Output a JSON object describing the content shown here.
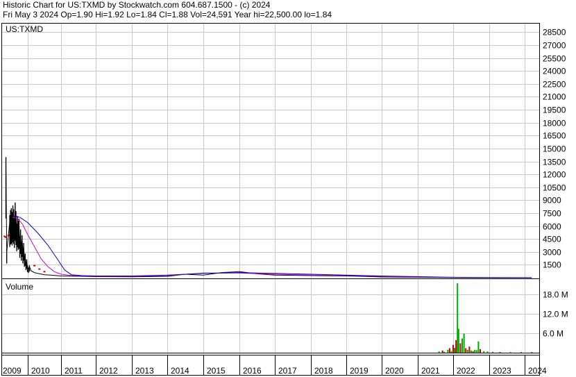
{
  "header": {
    "title": "Historic Chart for US:TXMD by Stockwatch.com 604.687.1500 - (c) 2024",
    "quote": "Fri May  3 2024   Op=1.90  Hi=1.92  Lo=1.84  Cl=1.88  Vol=24,591  Year hi=22,500.00  lo=1.84"
  },
  "colors": {
    "price": "#000000",
    "ma_short": "#cc00cc",
    "ma_long": "#0000cc",
    "volume_up": "#00aa00",
    "volume_down": "#cc0000",
    "grid": "#c8c8c8"
  },
  "chart_data": [
    {
      "type": "line",
      "symbol_label": "US:TXMD",
      "x_ticks": [
        "2009",
        "2010",
        "2011",
        "2012",
        "2013",
        "2014",
        "2015",
        "2016",
        "2017",
        "2018",
        "2019",
        "2020",
        "2021",
        "2022",
        "2023",
        "2024"
      ],
      "y_ticks": [
        28500,
        27000,
        25500,
        24000,
        22500,
        21000,
        19500,
        18000,
        16500,
        15000,
        13500,
        12000,
        10500,
        9000,
        7500,
        6000,
        4500,
        3000,
        1500
      ],
      "ylim": [
        0,
        29500
      ],
      "grid": true,
      "series": [
        {
          "role": "price",
          "x": [
            2009.15,
            2009.18,
            2009.3,
            2009.33,
            2009.36,
            2009.39,
            2009.42,
            2009.45,
            2009.48,
            2009.51,
            2009.54,
            2009.57,
            2009.6,
            2009.63,
            2009.66,
            2009.69,
            2009.72,
            2009.75,
            2009.78,
            2009.81,
            2009.84,
            2009.87,
            2009.9,
            2009.93,
            2009.96,
            2009.99,
            2010.02,
            2010.05,
            2010.1,
            2010.2,
            2010.3,
            2010.5,
            2010.7,
            2011.0,
            2011.3,
            2011.6,
            2012.0,
            2013.0,
            2014.0,
            2014.5,
            2015.0,
            2015.5,
            2016.0,
            2016.5,
            2017.0,
            2018.0,
            2019.0,
            2019.5,
            2020.0,
            2021.0,
            2022.0,
            2023.0,
            2024.2
          ],
          "y": [
            12500,
            3000,
            6500,
            7000,
            7200,
            6800,
            7500,
            7100,
            6300,
            7800,
            6900,
            5600,
            6400,
            5900,
            6100,
            4200,
            5000,
            3600,
            4400,
            3000,
            3600,
            2300,
            2500,
            1600,
            1900,
            1200,
            1000,
            1300,
            800,
            600,
            500,
            350,
            300,
            200,
            180,
            160,
            120,
            100,
            150,
            400,
            300,
            600,
            700,
            450,
            300,
            250,
            200,
            150,
            80,
            50,
            20,
            5,
            2
          ]
        },
        {
          "role": "ma_short",
          "x": [
            2009.4,
            2009.6,
            2009.8,
            2010.0,
            2010.2,
            2010.4,
            2010.6,
            2010.8,
            2011.0,
            2011.3,
            2012.0,
            2013.0,
            2014.0,
            2015.0,
            2016.0,
            2017.0,
            2018.0,
            2019.0,
            2020.0,
            2021.0,
            2022.0,
            2023.0,
            2024.2
          ],
          "y": [
            7000,
            6900,
            6200,
            5000,
            3600,
            2200,
            1300,
            700,
            400,
            250,
            150,
            150,
            250,
            550,
            550,
            400,
            300,
            250,
            150,
            80,
            30,
            10,
            5
          ]
        },
        {
          "role": "ma_long",
          "x": [
            2009.45,
            2009.7,
            2010.0,
            2010.3,
            2010.6,
            2010.9,
            2011.1,
            2011.3,
            2011.6,
            2012.0,
            2013.0,
            2014.0,
            2015.0,
            2016.0,
            2017.0,
            2018.0,
            2019.0,
            2020.0,
            2021.0,
            2022.0,
            2023.0,
            2024.2
          ],
          "y": [
            7200,
            7000,
            6400,
            5200,
            3800,
            2100,
            900,
            350,
            250,
            200,
            200,
            300,
            500,
            600,
            500,
            400,
            300,
            200,
            120,
            50,
            15,
            5
          ]
        },
        {
          "role": "price_ticks",
          "x": [
            2009.1,
            2009.14,
            2009.25,
            2010.2,
            2010.35,
            2010.5
          ],
          "y": [
            4800,
            4700,
            4900,
            1400,
            1000,
            700
          ]
        }
      ]
    },
    {
      "type": "bar",
      "title": "Volume",
      "y_ticks_label": [
        "18.0 M",
        "12.0 M",
        "6.0 M"
      ],
      "y_ticks": [
        18,
        12,
        6
      ],
      "ylim": [
        0,
        22.8
      ],
      "unit": "M",
      "x": [
        2021.6,
        2021.7,
        2021.75,
        2021.85,
        2021.9,
        2021.95,
        2022.0,
        2022.04,
        2022.08,
        2022.12,
        2022.15,
        2022.2,
        2022.25,
        2022.3,
        2022.35,
        2022.4,
        2022.45,
        2022.5,
        2022.55,
        2022.6,
        2022.65,
        2022.7,
        2022.75,
        2022.85,
        2022.95,
        2023.1,
        2023.3,
        2023.6,
        2023.9,
        2024.2
      ],
      "values": [
        0.5,
        0.8,
        0.4,
        1.0,
        1.5,
        0.6,
        2.5,
        1.6,
        4.0,
        21.5,
        7.5,
        3.0,
        4.5,
        6.0,
        1.5,
        1.0,
        2.0,
        0.8,
        0.6,
        1.0,
        0.9,
        3.6,
        1.2,
        0.6,
        0.5,
        0.4,
        0.3,
        0.3,
        0.3,
        0.3
      ],
      "direction": [
        "up",
        "down",
        "up",
        "up",
        "down",
        "up",
        "down",
        "up",
        "down",
        "up",
        "up",
        "down",
        "up",
        "up",
        "down",
        "up",
        "down",
        "up",
        "down",
        "up",
        "up",
        "up",
        "down",
        "up",
        "up",
        "up",
        "down",
        "up",
        "up",
        "down"
      ]
    }
  ]
}
